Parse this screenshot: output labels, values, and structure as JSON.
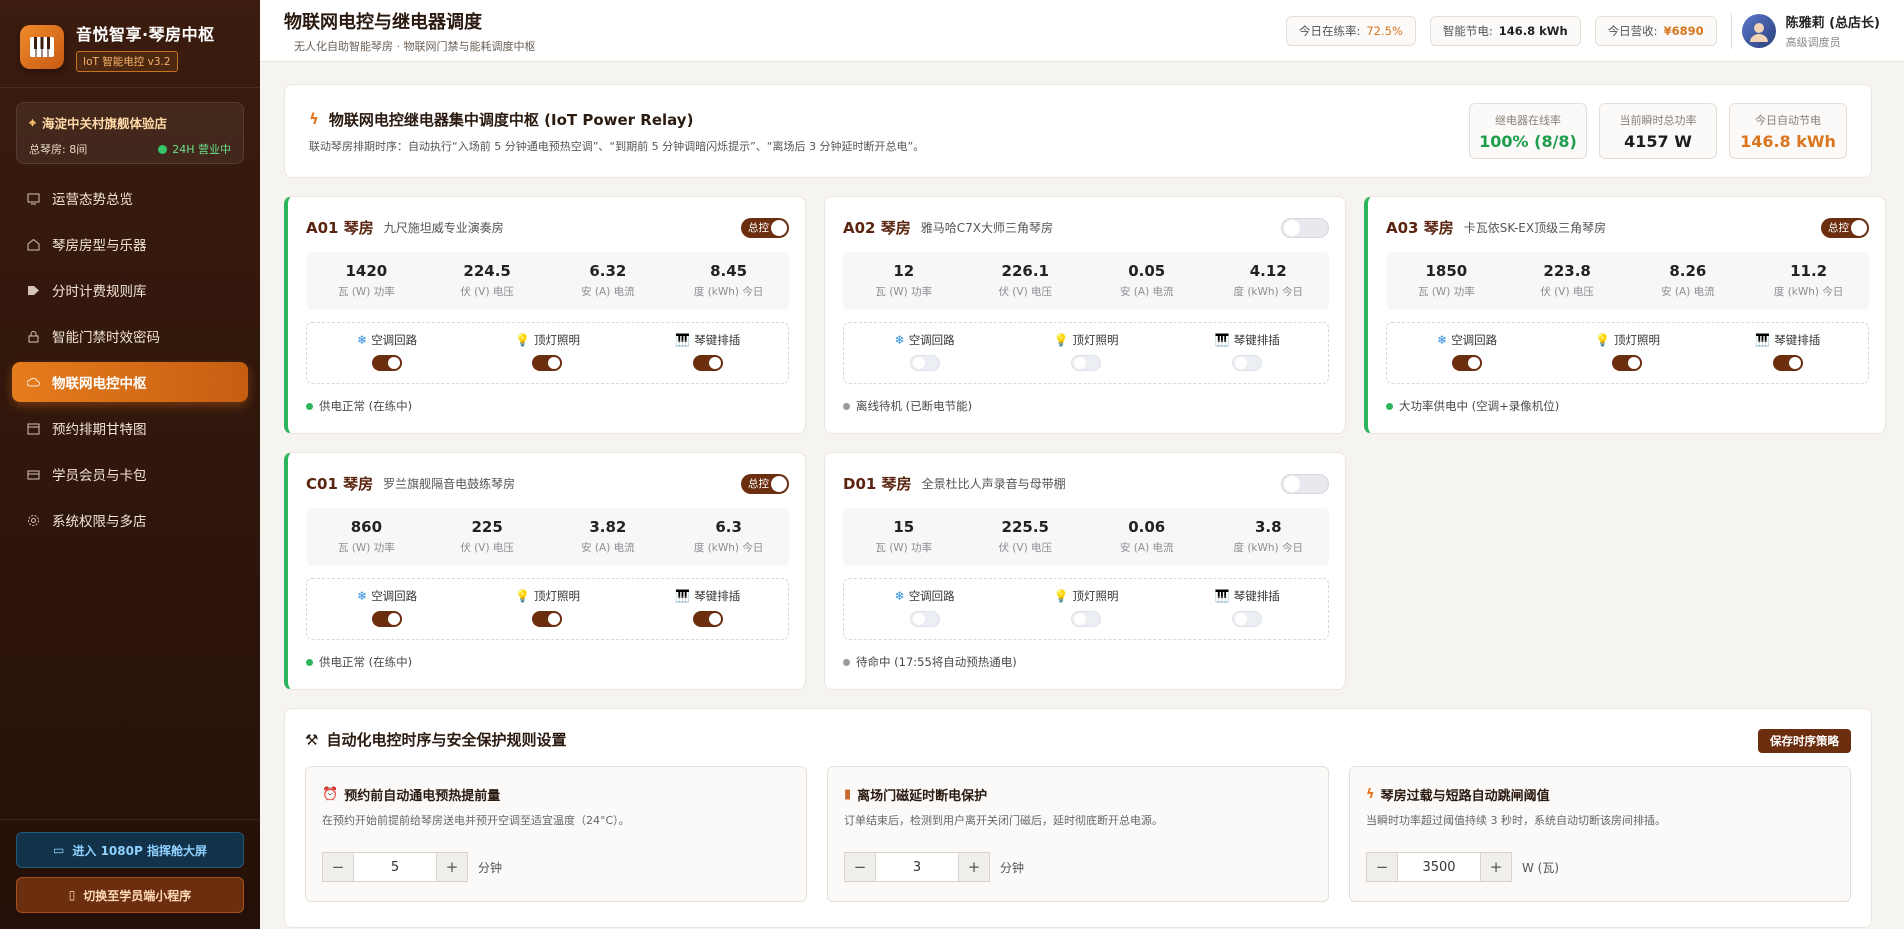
{
  "brand": {
    "title": "音悦智享·琴房中枢",
    "version": "IoT 智能电控 v3.2"
  },
  "store": {
    "name": "海淀中关村旗舰体验店",
    "rooms": "总琴房: 8间",
    "open": "24H 营业中"
  },
  "nav": [
    {
      "label": "运营态势总览",
      "icon": "chart-icon"
    },
    {
      "label": "琴房房型与乐器",
      "icon": "home-icon"
    },
    {
      "label": "分时计费规则库",
      "icon": "tag-icon"
    },
    {
      "label": "智能门禁时效密码",
      "icon": "lock-icon"
    },
    {
      "label": "物联网电控中枢",
      "icon": "cloud-icon",
      "active": true
    },
    {
      "label": "预约排期甘特图",
      "icon": "calendar-icon"
    },
    {
      "label": "学员会员与卡包",
      "icon": "card-icon"
    },
    {
      "label": "系统权限与多店",
      "icon": "gear-icon"
    }
  ],
  "sidebar_bottom": {
    "big_screen": "进入 1080P 指挥舱大屏",
    "mini_program": "切换至学员端小程序"
  },
  "header": {
    "title": "物联网电控与继电器调度",
    "subtitle": "无人化自助智能琴房 · 物联网门禁与能耗调度中枢",
    "practice_label": "今日在练率:",
    "practice_value": "72.5%",
    "saving_label": "智能节电:",
    "saving_value": "146.8 kWh",
    "revenue_label": "今日营收:",
    "revenue_value": "¥6890",
    "user_name": "陈雅莉 (总店长)",
    "user_role": "高级调度员"
  },
  "banner": {
    "title": "物联网电控继电器集中调度中枢 (IoT Power Relay)",
    "desc": "联动琴房排期时序：自动执行“入场前 5 分钟通电预热空调”、“到期前 5 分钟调暗闪烁提示”、“离场后 3 分钟延时断开总电”。",
    "stats": [
      {
        "label": "继电器在线率",
        "value": "100% (8/8)",
        "color": "#1f9d4c"
      },
      {
        "label": "当前瞬时总功率",
        "value": "4157 W",
        "color": "#1d1d1d"
      },
      {
        "label": "今日自动节电",
        "value": "146.8 kWh",
        "color": "#d9761f"
      }
    ]
  },
  "labels": {
    "main_switch": "总控",
    "power_unit": "瓦 (W) 功率",
    "volt_unit": "伏 (V) 电压",
    "amp_unit": "安 (A) 电流",
    "energy_unit": "度 (kWh) 今日",
    "ac": "空调回路",
    "light": "顶灯照明",
    "socket": "琴键排插"
  },
  "rooms": [
    {
      "name": "A01 琴房",
      "desc": "九尺施坦威专业演奏房",
      "on": true,
      "power": "1420",
      "volt": "224.5",
      "amp": "6.32",
      "energy": "8.45",
      "circuits": [
        true,
        true,
        true
      ],
      "status": "供电正常 (在练中)",
      "status_color": "#2db55d"
    },
    {
      "name": "A02 琴房",
      "desc": "雅马哈C7X大师三角琴房",
      "on": false,
      "power": "12",
      "volt": "226.1",
      "amp": "0.05",
      "energy": "4.12",
      "circuits": [
        false,
        false,
        false
      ],
      "status": "离线待机 (已断电节能)",
      "status_color": "#9a9a9a"
    },
    {
      "name": "A03 琴房",
      "desc": "卡瓦依SK-EX顶级三角琴房",
      "on": true,
      "power": "1850",
      "volt": "223.8",
      "amp": "8.26",
      "energy": "11.2",
      "circuits": [
        true,
        true,
        true
      ],
      "status": "大功率供电中 (空调+录像机位)",
      "status_color": "#2db55d"
    },
    {
      "name": "C01 琴房",
      "desc": "罗兰旗舰隔音电鼓练琴房",
      "on": true,
      "power": "860",
      "volt": "225",
      "amp": "3.82",
      "energy": "6.3",
      "circuits": [
        true,
        true,
        true
      ],
      "status": "供电正常 (在练中)",
      "status_color": "#2db55d"
    },
    {
      "name": "D01 琴房",
      "desc": "全景杜比人声录音与母带棚",
      "on": false,
      "power": "15",
      "volt": "225.5",
      "amp": "0.06",
      "energy": "3.8",
      "circuits": [
        false,
        false,
        false
      ],
      "status": "待命中 (17:55将自动预热通电)",
      "status_color": "#9a9a9a"
    }
  ],
  "rules": {
    "title": "自动化电控时序与安全保护规则设置",
    "save": "保存时序策略",
    "items": [
      {
        "title": "预约前自动通电预热提前量",
        "desc": "在预约开始前提前给琴房送电并预开空调至适宜温度（24°C）。",
        "value": "5",
        "unit": "分钟",
        "icon": "alarm-clock-icon"
      },
      {
        "title": "离场门磁延时断电保护",
        "desc": "订单结束后，检测到用户离开关闭门磁后，延时彻底断开总电源。",
        "value": "3",
        "unit": "分钟",
        "icon": "door-icon"
      },
      {
        "title": "琴房过载与短路自动跳闸阈值",
        "desc": "当瞬时功率超过阈值持续 3 秒时，系统自动切断该房间排插。",
        "value": "3500",
        "unit": "W (瓦)",
        "icon": "lightning-icon"
      }
    ]
  }
}
